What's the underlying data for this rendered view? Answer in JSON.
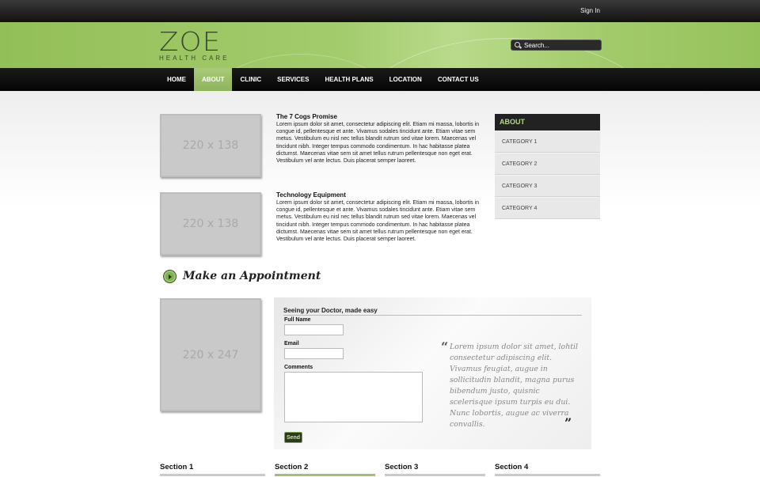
{
  "topbar": {
    "signin": "Sign In"
  },
  "header": {
    "logo_main": "ZOE",
    "logo_sub": "HEALTH CARE",
    "search_placeholder": "Search..."
  },
  "nav": [
    {
      "label": "HOME",
      "active": false
    },
    {
      "label": "ABOUT",
      "active": true
    },
    {
      "label": "CLINIC",
      "active": false
    },
    {
      "label": "SERVICES",
      "active": false
    },
    {
      "label": "HEALTH PLANS",
      "active": false
    },
    {
      "label": "LOCATION",
      "active": false
    },
    {
      "label": "CONTACT US",
      "active": false
    }
  ],
  "articles": [
    {
      "image_label": "220 x 138",
      "title": "The 7 Cogs Promise",
      "body": "Lorem ipsum dolor sit amet, consectetur adipiscing elit. Etiam mi massa, lobortis in congue id, pellentesque et ante. Vivamus sodales tincidunt ante. Etiam vitae sem metus. Vestibulum eu nisl nec tellus blandit rutrum sed vitae lorem. Maecenas vel tincidunt nibh. Integer tempus commodo condimentum. In hac habitasse platea dictumst. Maecenas vitae sem sit amet tellus rutrum pellentesque non eget erat. Vestibulum vel ante lectus. Duis placerat semper laoreet."
    },
    {
      "image_label": "220 x 138",
      "title": "Technology Equipment",
      "body": "Lorem ipsum dolor sit amet, consectetur adipiscing elit. Etiam mi massa, lobortis in congue id, pellentesque et ante. Vivamus sodales tincidunt ante. Etiam vitae sem metus. Vestibulum eu nisl nec tellus blandit rutrum sed vitae lorem. Maecenas vel tincidunt nibh. Integer tempus commodo condimentum. In hac habitasse platea dictumst. Maecenas vitae sem sit amet tellus rutrum pellentesque non eget erat. Vestibulum vel ante lectus. Duis placerat semper laoreet."
    }
  ],
  "sidebar": {
    "heading": "ABOUT",
    "items": [
      "CATEGORY 1",
      "CATEGORY 2",
      "CATEGORY 3",
      "CATEGORY 4"
    ]
  },
  "appointment": {
    "title": "Make an Appointment",
    "image_label": "220 x 247",
    "form_title": "Seeing your Doctor, made easy",
    "full_name_label": "Full Name",
    "email_label": "Email",
    "comments_label": "Comments",
    "send_label": "Send",
    "quote": "Lorem ipsum dolor sit amet, lohtil consectetur adipiscing elit. Vivamus feugiat, augue in sollicitudin blandit, magna purus bibendum justo, quisnic scelerisque ipsum turpis eu dui. Nunc lobortis, augue ac viverra convallis.",
    "quote_open": "“",
    "quote_close": "”"
  },
  "sections": [
    {
      "label": "Section 1",
      "active": false
    },
    {
      "label": "Section 2",
      "active": true
    },
    {
      "label": "Section 3",
      "active": false
    },
    {
      "label": "Section 4",
      "active": false
    }
  ],
  "colors": {
    "accent_green": "#9cc46a",
    "nav_dark": "#111111"
  }
}
